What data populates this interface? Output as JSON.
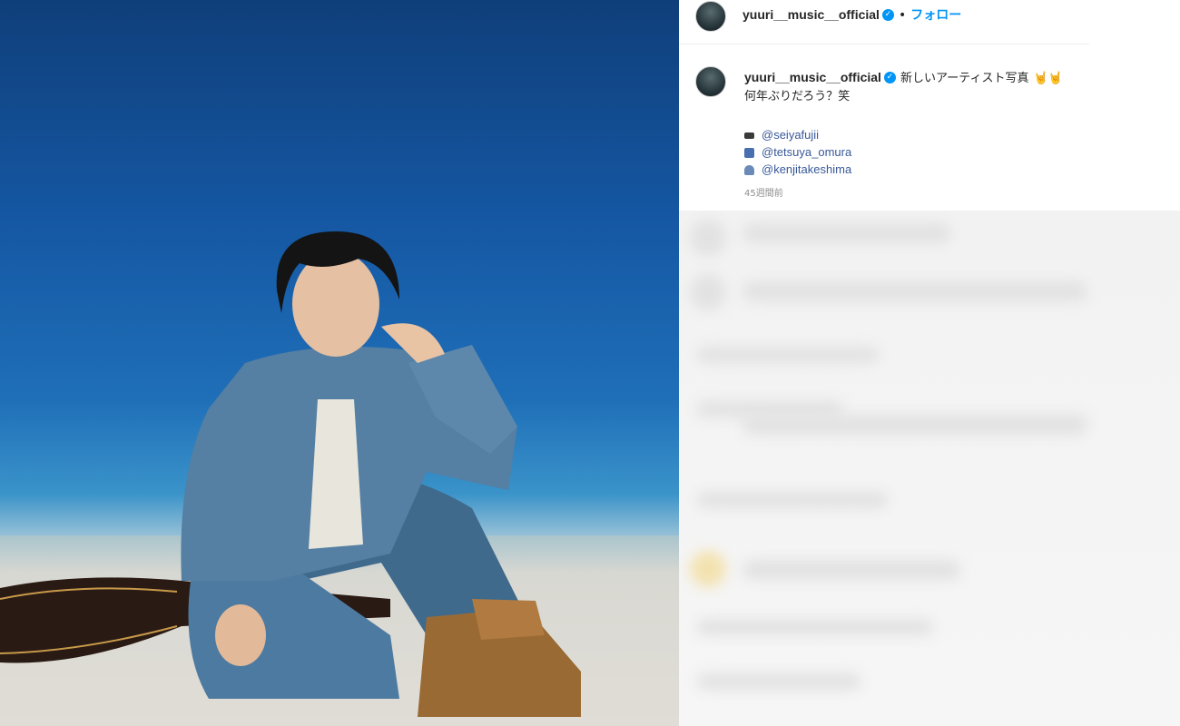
{
  "header": {
    "username": "yuuri__music__official",
    "verified": true,
    "separator": "•",
    "follow_label": "フォロー"
  },
  "caption": {
    "username": "yuuri__music__official",
    "line1": "新しいアーティスト写真",
    "line1_emoji": "🤘🤘",
    "line2": "何年ぶりだろう？笑",
    "credits": [
      {
        "icon": "camera-icon",
        "handle": "@seiyafujii"
      },
      {
        "icon": "shirt-icon",
        "handle": "@tetsuya_omura"
      },
      {
        "icon": "hairdresser-icon",
        "handle": "@kenjitakeshima"
      }
    ],
    "time_ago": "45週間前"
  },
  "colors": {
    "accent": "#0095f6",
    "mention": "#385898",
    "photo_bg": "#1557a3"
  }
}
